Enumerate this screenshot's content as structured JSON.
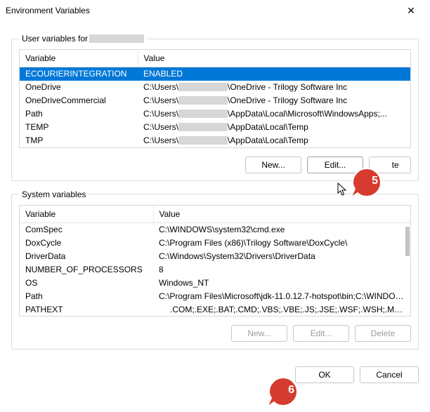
{
  "window": {
    "title": "Environment Variables",
    "close_glyph": "✕"
  },
  "user_section": {
    "legend_prefix": "User variables for ",
    "columns": {
      "var": "Variable",
      "val": "Value"
    },
    "rows": [
      {
        "var": "ECOURIERINTEGRATION",
        "val_full": "ENABLED",
        "selected": true
      },
      {
        "var": "OneDrive",
        "val_pre": "C:\\Users\\",
        "val_post": "\\OneDrive - Trilogy Software Inc"
      },
      {
        "var": "OneDriveCommercial",
        "val_pre": "C:\\Users\\",
        "val_post": "\\OneDrive - Trilogy Software Inc"
      },
      {
        "var": "Path",
        "val_pre": "C:\\Users\\",
        "val_post": "\\AppData\\Local\\Microsoft\\WindowsApps;..."
      },
      {
        "var": "TEMP",
        "val_pre": "C:\\Users\\",
        "val_post": "\\AppData\\Local\\Temp"
      },
      {
        "var": "TMP",
        "val_pre": "C:\\Users\\",
        "val_post": "\\AppData\\Local\\Temp"
      }
    ],
    "buttons": {
      "new": "New...",
      "edit": "Edit...",
      "delete": "Delete"
    }
  },
  "system_section": {
    "legend": "System variables",
    "columns": {
      "var": "Variable",
      "val": "Value"
    },
    "rows": [
      {
        "var": "ComSpec",
        "val": "C:\\WINDOWS\\system32\\cmd.exe"
      },
      {
        "var": "DoxCycle",
        "val": "C:\\Program Files (x86)\\Trilogy Software\\DoxCycle\\"
      },
      {
        "var": "DriverData",
        "val": "C:\\Windows\\System32\\Drivers\\DriverData"
      },
      {
        "var": "NUMBER_OF_PROCESSORS",
        "val": "8"
      },
      {
        "var": "OS",
        "val": "Windows_NT"
      },
      {
        "var": "Path",
        "val": "C:\\Program Files\\Microsoft\\jdk-11.0.12.7-hotspot\\bin;C:\\WINDOW..."
      },
      {
        "var": "PATHEXT",
        "val": ".COM;.EXE;.BAT;.CMD;.VBS;.VBE;.JS;.JSE;.WSF;.WSH;.MSC",
        "indent": true
      }
    ],
    "buttons": {
      "new": "New...",
      "edit": "Edit...",
      "delete": "Delete"
    }
  },
  "dialog_buttons": {
    "ok": "OK",
    "cancel": "Cancel"
  },
  "callouts": {
    "c5": "5",
    "c6": "6"
  }
}
